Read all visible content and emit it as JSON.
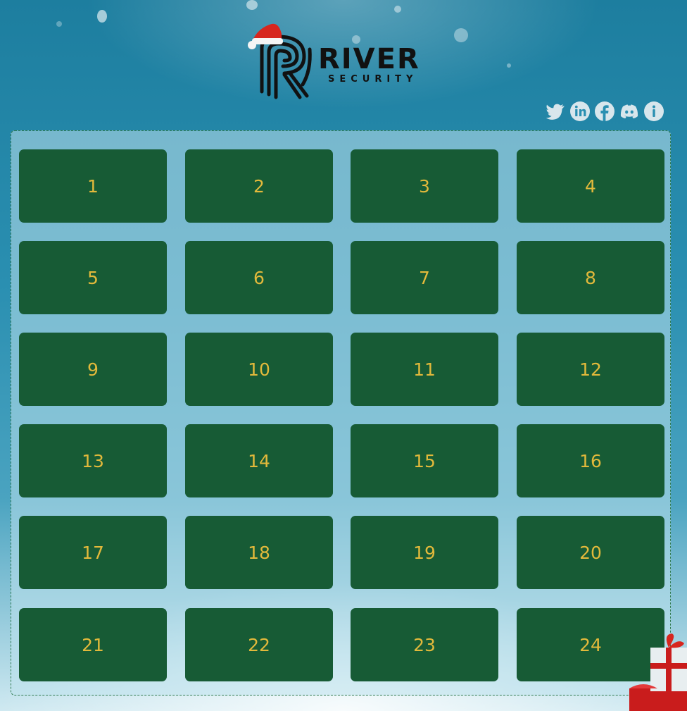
{
  "brand": {
    "name": "RIVER",
    "tagline": "SECURITY"
  },
  "social": [
    {
      "icon": "twitter-icon"
    },
    {
      "icon": "linkedin-icon"
    },
    {
      "icon": "facebook-icon"
    },
    {
      "icon": "discord-icon"
    },
    {
      "icon": "info-icon"
    }
  ],
  "doors": [
    "1",
    "2",
    "3",
    "4",
    "5",
    "6",
    "7",
    "8",
    "9",
    "10",
    "11",
    "12",
    "13",
    "14",
    "15",
    "16",
    "17",
    "18",
    "19",
    "20",
    "21",
    "22",
    "23",
    "24"
  ],
  "colors": {
    "door_bg": "#175b35",
    "door_text": "#e2b93b",
    "background": "#2a8fb1",
    "icon": "#d8e6ec"
  }
}
